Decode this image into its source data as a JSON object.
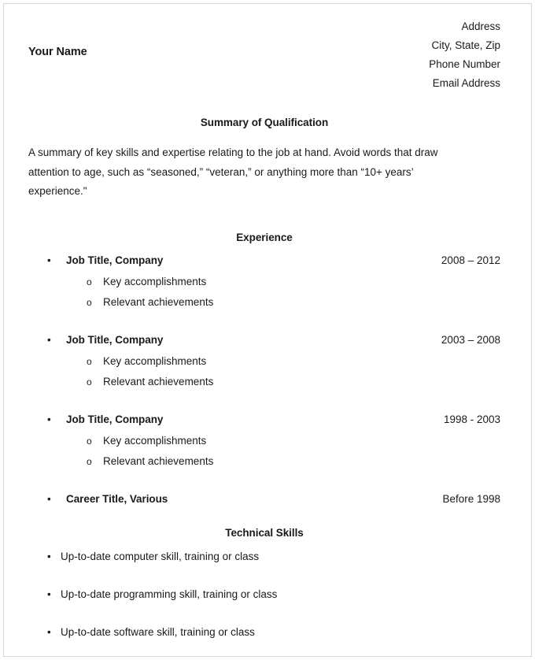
{
  "header": {
    "name": "Your Name",
    "contact": [
      "Address",
      "City, State, Zip",
      "Phone Number",
      "Email Address"
    ]
  },
  "summary": {
    "heading": "Summary of Qualification",
    "body": "A summary of key skills and expertise relating to the job at hand.  Avoid words that draw attention to age, such as “seasoned,” “veteran,” or anything more than “10+ years’ experience.\""
  },
  "experience": {
    "heading": "Experience",
    "jobs": [
      {
        "title": "Job Title, Company",
        "dates": "2008 – 2012",
        "bullets": [
          "Key accomplishments",
          "Relevant achievements"
        ]
      },
      {
        "title": "Job Title, Company",
        "dates": "2003 – 2008",
        "bullets": [
          "Key accomplishments",
          "Relevant achievements"
        ]
      },
      {
        "title": "Job Title, Company",
        "dates": "1998 - 2003",
        "bullets": [
          "Key accomplishments",
          "Relevant achievements"
        ]
      }
    ],
    "career": {
      "title": "Career Title, Various",
      "dates": "Before 1998"
    }
  },
  "skills": {
    "heading": "Technical Skills",
    "items": [
      "Up-to-date computer skill, training or class",
      "Up-to-date programming skill, training or class",
      "Up-to-date software skill, training or class"
    ]
  },
  "glyphs": {
    "disc": "•",
    "circle": "o"
  }
}
